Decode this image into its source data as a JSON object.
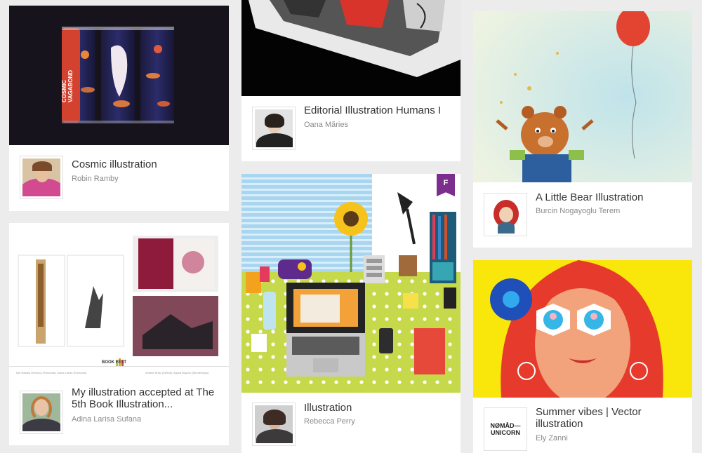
{
  "colors": {
    "page_bg": "#ececec",
    "card_bg": "#ffffff",
    "title": "#333333",
    "owner": "#8a8a8a",
    "badge": "#7b2e8e"
  },
  "projects": [
    {
      "title": "Cosmic illustration",
      "owner": "Robin Ramby",
      "cover_text": "COSMIC VAGABOND",
      "avatar_text": ""
    },
    {
      "title": "My illustration accepted at The 5th Book Illustration...",
      "owner": "Adina Larisa Sufana",
      "cover_text": "BOOK FEST",
      "avatar_text": ""
    },
    {
      "title": "Editorial Illustration Humans I",
      "owner": "Oana Măries",
      "cover_text": "",
      "avatar_text": ""
    },
    {
      "title": "Illustration",
      "owner": "Rebecca Perry",
      "cover_text": "",
      "avatar_text": "",
      "badge": "F"
    },
    {
      "title": "A Little Bear Illustration",
      "owner": "Burcin Nogayoglu Terem",
      "cover_text": "",
      "avatar_text": ""
    },
    {
      "title": "Summer vibes | Vector illustration",
      "owner": "Ely Zanni",
      "cover_text": "",
      "avatar_text": "NØMÅD— UNICORN"
    }
  ]
}
